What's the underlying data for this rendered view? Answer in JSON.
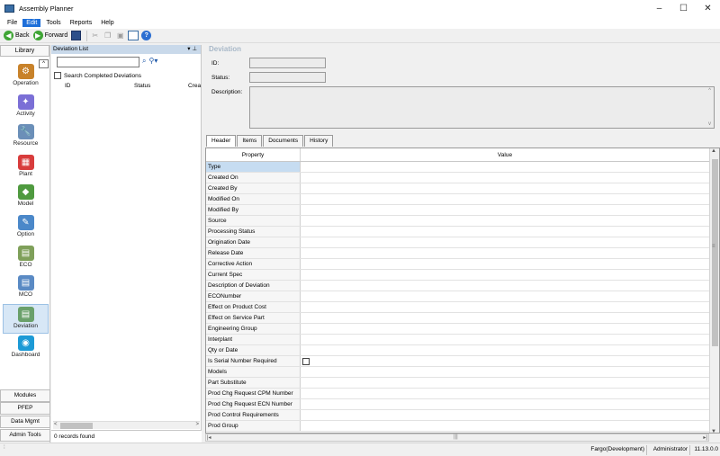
{
  "window": {
    "title": "Assembly Planner",
    "minimize": "–",
    "maximize": "☐",
    "close": "✕"
  },
  "menu": [
    "File",
    "Edit",
    "Tools",
    "Reports",
    "Help"
  ],
  "toolbar": {
    "back": "Back",
    "forward": "Forward"
  },
  "library": {
    "header": "Library",
    "items": [
      {
        "label": "Operation",
        "color": "#c8822a",
        "glyph": "⚙"
      },
      {
        "label": "Activity",
        "color": "#7b6fd6",
        "glyph": "✦"
      },
      {
        "label": "Resource",
        "color": "#6b8fb8",
        "glyph": "🔧"
      },
      {
        "label": "Plant",
        "color": "#d83c3c",
        "glyph": "▦"
      },
      {
        "label": "Model",
        "color": "#4f9a3f",
        "glyph": "◆"
      },
      {
        "label": "Option",
        "color": "#4b88c9",
        "glyph": "✎"
      },
      {
        "label": "ECO",
        "color": "#7fa05a",
        "glyph": "▤"
      },
      {
        "label": "MCO",
        "color": "#5a8ac4",
        "glyph": "▤"
      },
      {
        "label": "Deviation",
        "color": "#6aa06a",
        "glyph": "▤"
      },
      {
        "label": "Dashboard",
        "color": "#1c9ad6",
        "glyph": "◉"
      }
    ],
    "bottom": [
      "Modules",
      "PFEP",
      "Data Mgmt",
      "Admin Tools"
    ]
  },
  "deviation_list": {
    "title": "Deviation List",
    "pin": "▾ ⊥",
    "checkbox_label": "Search Completed Deviations",
    "columns": [
      "ID",
      "Status",
      "Crea"
    ],
    "status": "0 records found",
    "arrow_left": "<",
    "arrow_right": ">"
  },
  "deviation": {
    "title": "Deviation",
    "id_label": "ID:",
    "status_label": "Status:",
    "description_label": "Description:",
    "scroll_up": "^",
    "scroll_down": "v"
  },
  "tabs": [
    "Header",
    "Items",
    "Documents",
    "History"
  ],
  "grid": {
    "columns": [
      "Property",
      "Value"
    ],
    "rows": [
      "Type",
      "Created On",
      "Created By",
      "Modified On",
      "Modified By",
      "Source",
      "Processing Status",
      "Origination Date",
      "Release Date",
      "Corrective Action",
      "Current Spec",
      "Description of Deviation",
      "ECONumber",
      "Effect on Product Cost",
      "Effect on Service Part",
      "Engineering Group",
      "Interplant",
      "Qty or Date",
      "Is Serial Number Required",
      "Models",
      "Part Substitute",
      "Prod Chg Request CPM Number",
      "Prod Chg Request ECN Number",
      "Prod Control Requirements",
      "Prod Group"
    ],
    "selected_row": "Type",
    "checkbox_row": "Is Serial Number Required",
    "scroll_up": "▲",
    "scroll_down": "▼",
    "scroll_left": "|◂",
    "scroll_right": "▸|",
    "grip": "≡",
    "h_grip": "|||"
  },
  "statusbar": {
    "grip": "⁞",
    "environment": "Fargo(Development)",
    "user": "Administrator",
    "version": "11.13.0.0"
  }
}
